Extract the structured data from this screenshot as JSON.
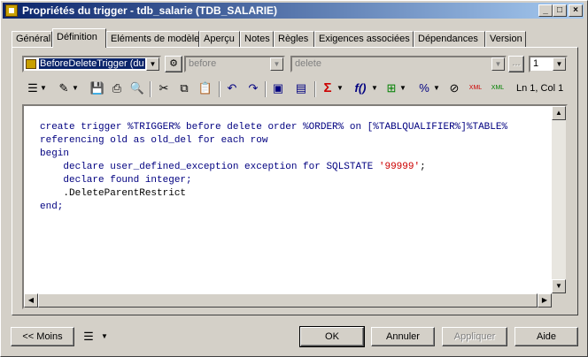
{
  "window": {
    "title": "Propriétés du trigger - tdb_salarie (TDB_SALARIE)"
  },
  "tabs": [
    {
      "label": "Général"
    },
    {
      "label": "Définition"
    },
    {
      "label": "Eléments de modèle"
    },
    {
      "label": "Aperçu"
    },
    {
      "label": "Notes"
    },
    {
      "label": "Règles"
    },
    {
      "label": "Exigences associées"
    },
    {
      "label": "Dépendances"
    },
    {
      "label": "Version"
    }
  ],
  "definition": {
    "template": "BeforeDeleteTrigger (du",
    "time": "before",
    "event": "delete",
    "order": "1",
    "cursor_position": "Ln 1, Col 1"
  },
  "code": {
    "lines": [
      [
        "create trigger %TRIGGER% before delete order %ORDER% on [%TABLQUALIFIER%]%TABLE%"
      ],
      [
        "referencing old as old_del for each row"
      ],
      [
        "begin"
      ],
      [
        "    declare user_defined_exception exception for SQLSTATE ",
        "'99999'",
        ";"
      ],
      [
        "    declare found integer;"
      ],
      [
        "    ",
        ".DeleteParentRestrict"
      ],
      [
        "end;"
      ]
    ]
  },
  "footer": {
    "less": "<< Moins",
    "ok": "OK",
    "cancel": "Annuler",
    "apply": "Appliquer",
    "help": "Aide"
  }
}
